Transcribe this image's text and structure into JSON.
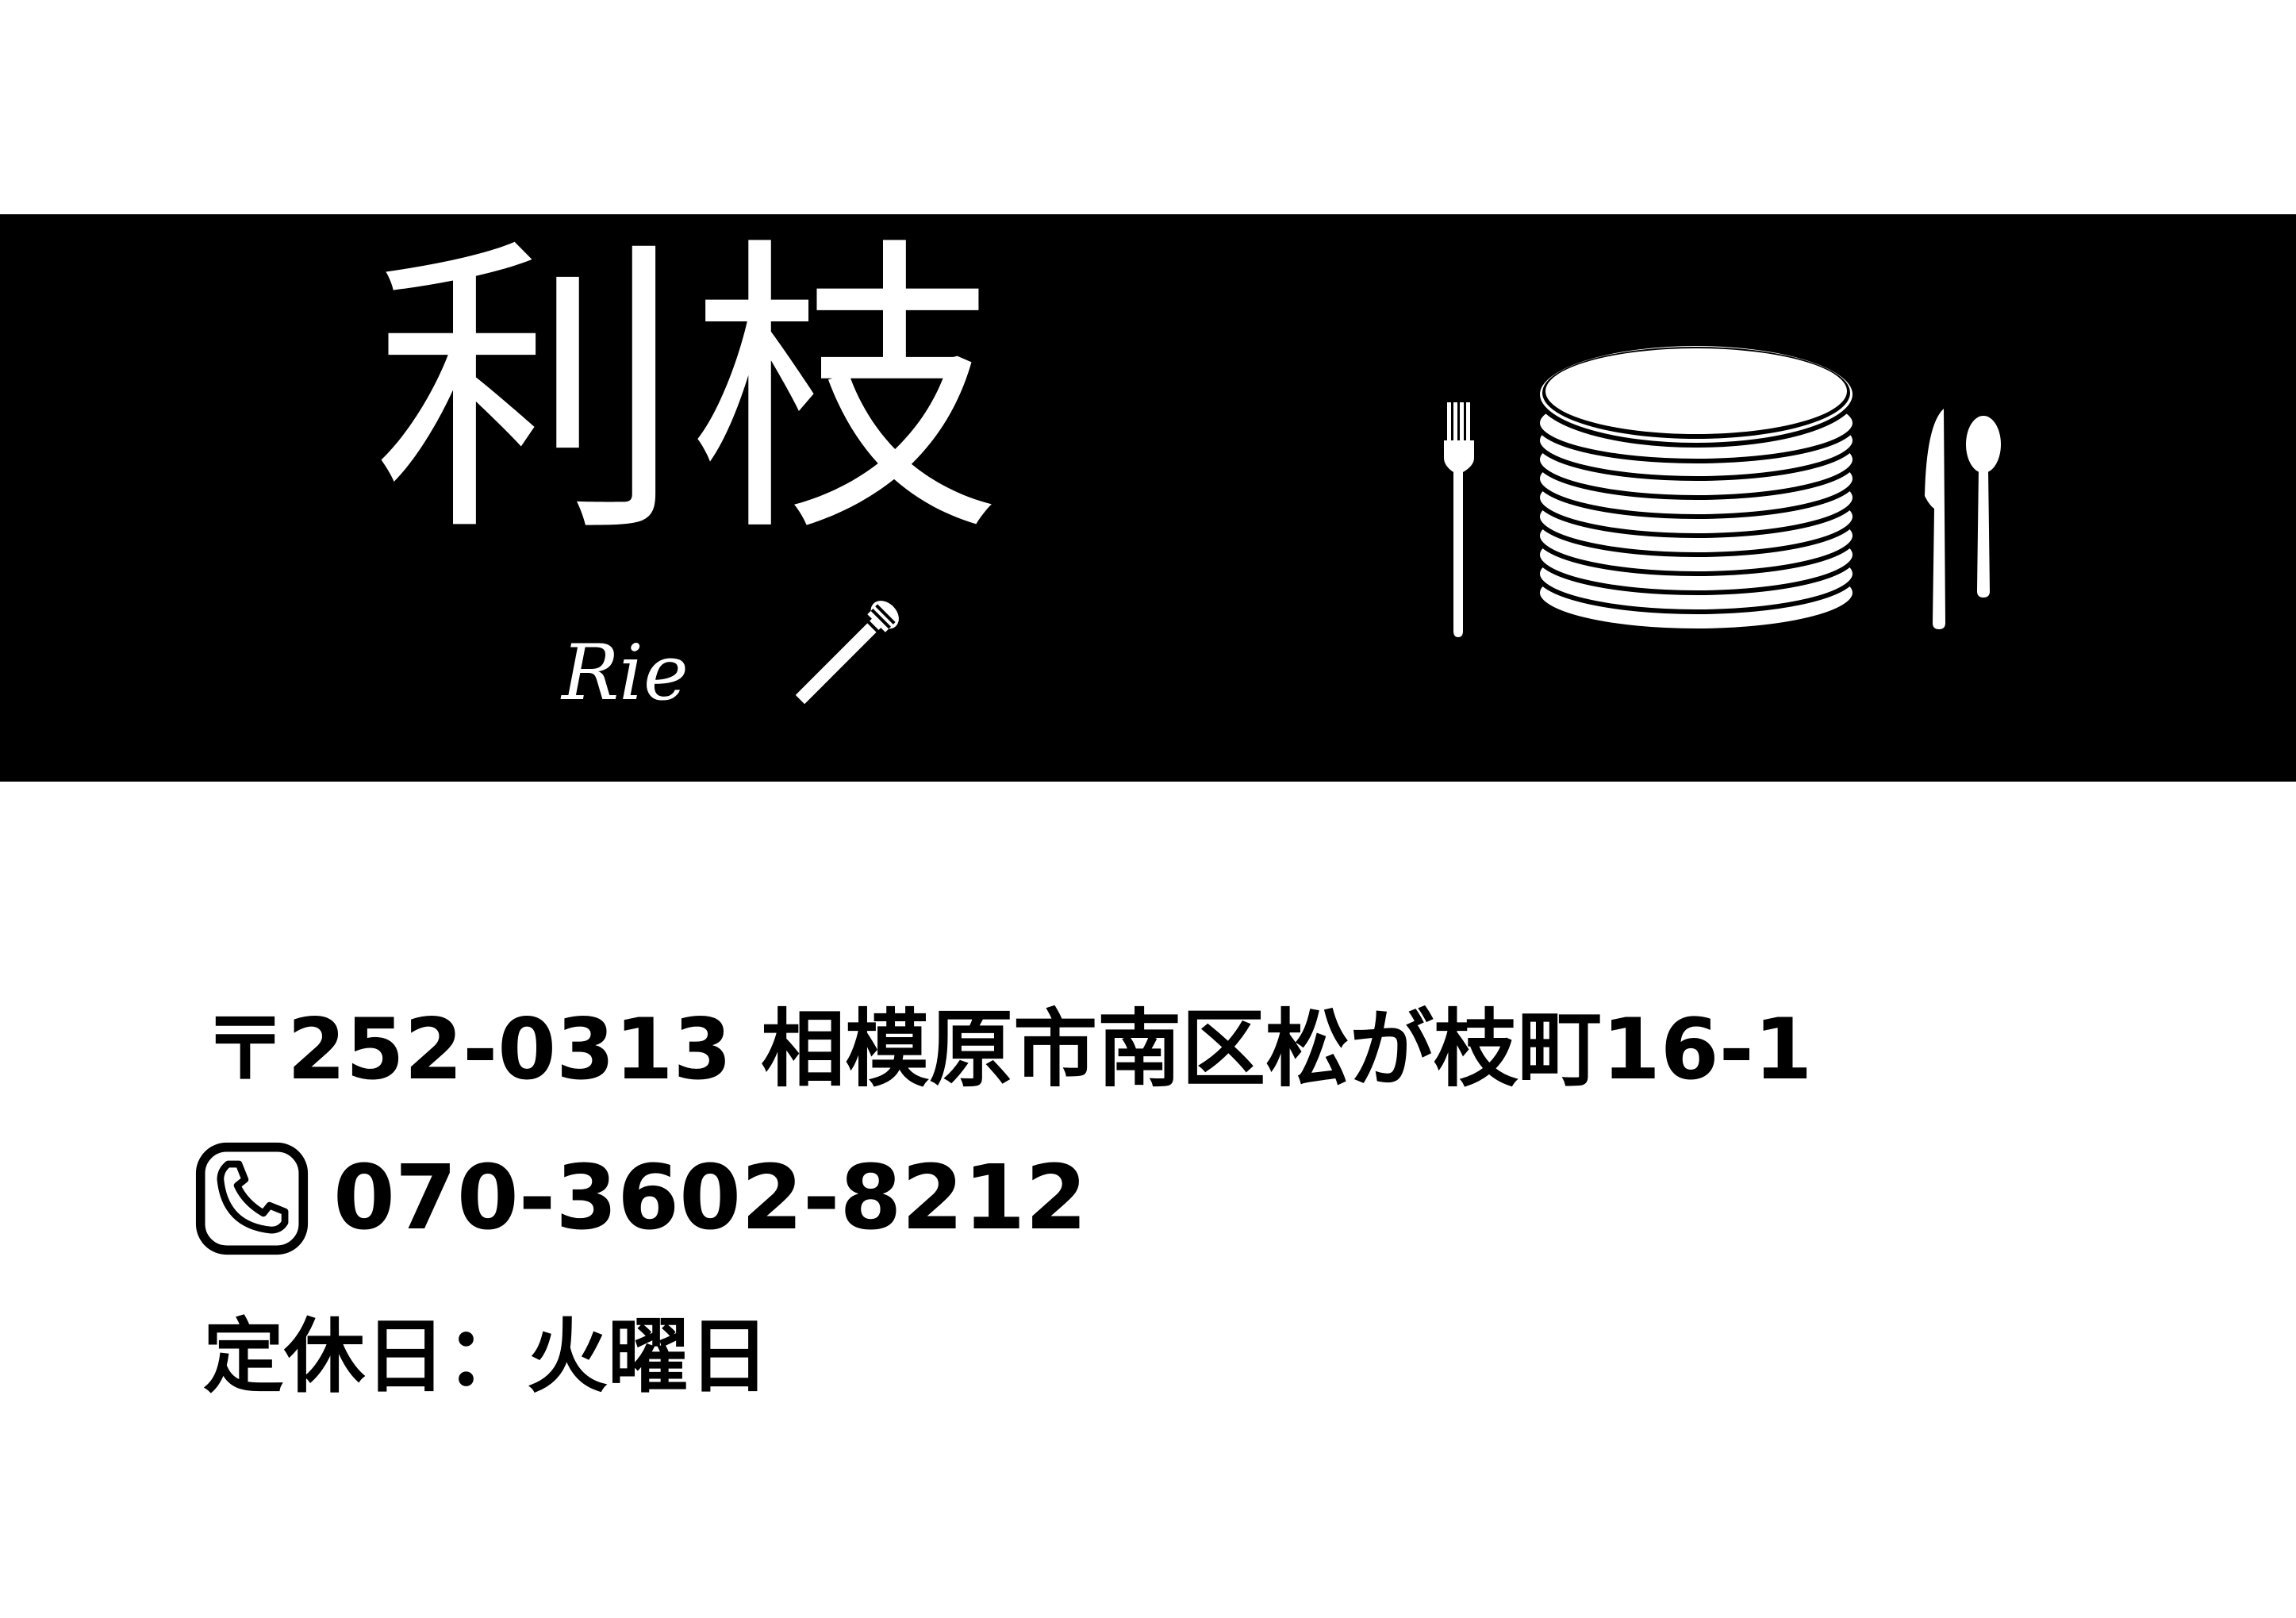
{
  "shop": {
    "name": "利枝",
    "romaji": "Rie"
  },
  "icons": {
    "microphone": "microphone-icon",
    "fork": "fork-icon",
    "plates": "stacked-plates-icon",
    "knife": "knife-icon",
    "spoon": "spoon-icon",
    "phone": "phone-icon"
  },
  "contact": {
    "address": "〒252-0313 相模原市南区松が枝町16-1",
    "phone": "070-3602-8212",
    "holiday": "定休日：火曜日"
  },
  "colors": {
    "banner": "#000000",
    "background": "#ffffff",
    "text": "#000000"
  }
}
